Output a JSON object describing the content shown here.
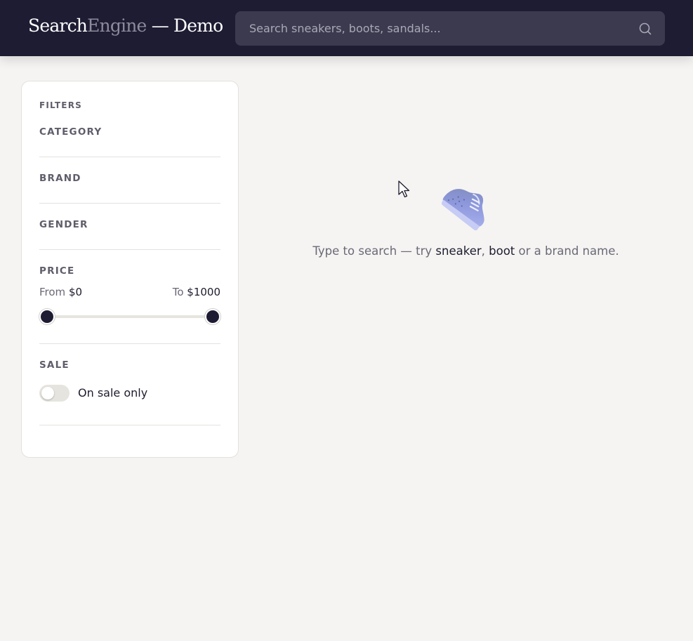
{
  "header": {
    "brand_part1": "Search",
    "brand_part2": "Engine",
    "brand_part3": " — Demo",
    "search_placeholder": "Search sneakers, boots, sandals..."
  },
  "sidebar": {
    "title": "FILTERS",
    "sections": {
      "category": "CATEGORY",
      "brand": "BRAND",
      "gender": "GENDER",
      "price": "PRICE",
      "sale": "SALE"
    },
    "price": {
      "from_label": "From",
      "from_value": "$0",
      "to_label": "To",
      "to_value": "$1000",
      "range_min": 0,
      "range_max": 1000,
      "selected_min": 0,
      "selected_max": 1000
    },
    "sale": {
      "toggle_label": "On sale only",
      "toggle_on": false
    }
  },
  "main": {
    "empty_prefix": "Type to search — try ",
    "keyword1": "sneaker",
    "sep": ", ",
    "keyword2": "boot",
    "empty_suffix": " or a brand name.",
    "illustration": "sneaker-icon"
  },
  "colors": {
    "header_bg": "#1e1c33",
    "page_bg": "#f5f4f2",
    "accent": "#1e1c33",
    "shoe_main": "#8c97dc"
  }
}
